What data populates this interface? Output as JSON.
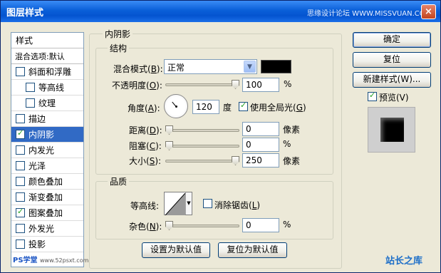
{
  "window": {
    "title": "图层样式",
    "watermark": "思缘设计论坛  WWW.MISSVUAN.COM",
    "close": "×"
  },
  "sidebar": {
    "header": "样式",
    "blend": "混合选项:默认",
    "items": [
      {
        "label": "斜面和浮雕",
        "checked": false
      },
      {
        "label": "等高线",
        "checked": false
      },
      {
        "label": "纹理",
        "checked": false
      },
      {
        "label": "描边",
        "checked": false
      },
      {
        "label": "内阴影",
        "checked": true
      },
      {
        "label": "内发光",
        "checked": false
      },
      {
        "label": "光泽",
        "checked": false
      },
      {
        "label": "颜色叠加",
        "checked": false
      },
      {
        "label": "渐变叠加",
        "checked": false
      },
      {
        "label": "图案叠加",
        "checked": true
      },
      {
        "label": "外发光",
        "checked": false
      },
      {
        "label": "投影",
        "checked": false
      }
    ],
    "footer_watermark": "PS学堂",
    "footer_sub": "www.52psxt.com"
  },
  "panel": {
    "group_title": "内阴影",
    "structure": {
      "title": "结构",
      "blend_mode_label": "混合模式(",
      "blend_mode_key": "B",
      "blend_mode_value": "正常",
      "shadow_color": "#000000",
      "opacity_label": "不透明度(",
      "opacity_key": "O",
      "opacity_value": "100",
      "opacity_unit": "%",
      "opacity_fraction": 1.0,
      "angle_label": "角度(",
      "angle_key": "A",
      "angle_value": "120",
      "angle_unit": "度",
      "global_light_label": "使用全局光(",
      "global_light_key": "G",
      "global_light_checked": true,
      "distance_label": "距离(",
      "distance_key": "D",
      "distance_value": "0",
      "distance_unit": "像素",
      "distance_fraction": 0.0,
      "choke_label": "阻塞(",
      "choke_key": "C",
      "choke_value": "0",
      "choke_unit": "%",
      "choke_fraction": 0.0,
      "size_label": "大小(",
      "size_key": "S",
      "size_value": "250",
      "size_unit": "像素",
      "size_fraction": 1.0
    },
    "quality": {
      "title": "品质",
      "contour_label": "等高线:",
      "antialias_label": "消除锯齿(",
      "antialias_key": "L",
      "antialias_checked": false,
      "noise_label": "杂色(",
      "noise_key": "N",
      "noise_value": "0",
      "noise_unit": "%",
      "noise_fraction": 0.0
    },
    "set_default": "设置为默认值",
    "reset_default": "复位为默认值"
  },
  "buttons": {
    "ok": "确定",
    "reset": "复位",
    "new_style": "新建样式(W)...",
    "preview_label": "预览(V)",
    "preview_checked": true
  },
  "bottom_watermark": "站长之库"
}
